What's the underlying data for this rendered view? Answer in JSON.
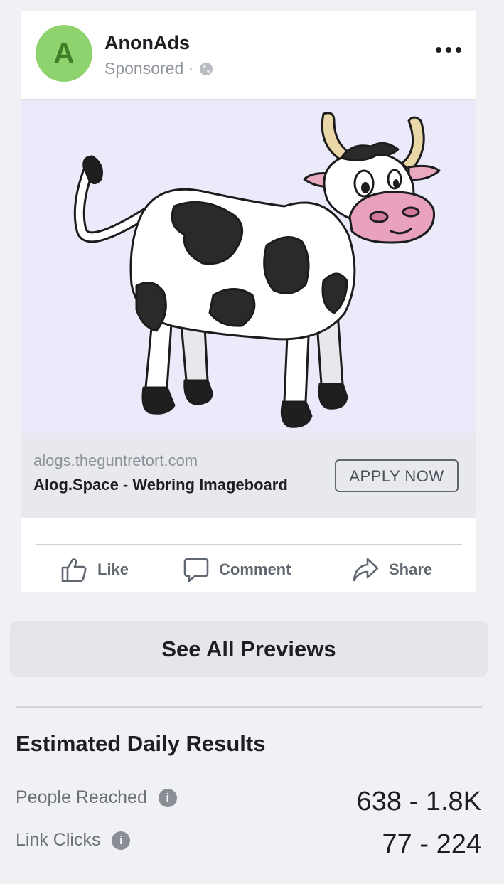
{
  "post": {
    "avatar_letter": "A",
    "page_name": "AnonAds",
    "sponsored_label": "Sponsored · "
  },
  "link": {
    "domain": "alogs.theguntretort.com",
    "title": "Alog.Space - Webring Imageboard",
    "cta_label": "APPLY NOW"
  },
  "actions": {
    "like_label": "Like",
    "comment_label": "Comment",
    "share_label": "Share"
  },
  "see_all_label": "See All Previews",
  "results": {
    "title": "Estimated Daily Results",
    "metrics": [
      {
        "label": "People Reached",
        "value": "638 - 1.8K"
      },
      {
        "label": "Link Clicks",
        "value": "77 - 224"
      }
    ]
  },
  "colors": {
    "avatar_bg": "#8fd36e",
    "image_bg": "#eaeafb",
    "page_bg": "#f0f1f5"
  },
  "icons": [
    "globe-icon",
    "more-icon",
    "like-icon",
    "comment-icon",
    "share-icon",
    "info-icon"
  ]
}
